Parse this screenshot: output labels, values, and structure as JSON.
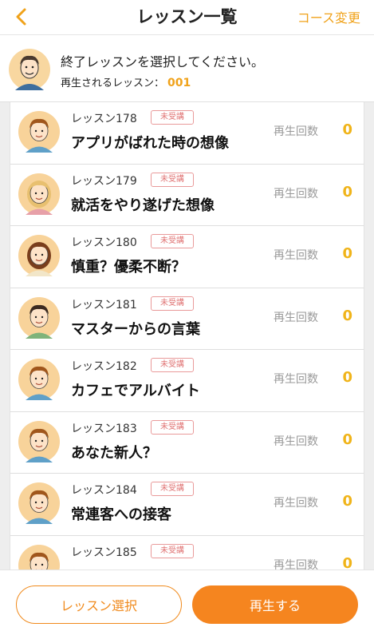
{
  "header": {
    "title": "レッスン一覧",
    "course_change": "コース変更"
  },
  "info": {
    "message": "終了レッスンを選択してください。",
    "current_label": "再生されるレッスン：",
    "current_number": "001"
  },
  "lessons": [
    {
      "label": "レッスン178",
      "badge": "未受講",
      "title": "アプリがばれた時の想像",
      "play_label": "再生回数",
      "play_count": "0"
    },
    {
      "label": "レッスン179",
      "badge": "未受講",
      "title": "就活をやり遂げた想像",
      "play_label": "再生回数",
      "play_count": "0"
    },
    {
      "label": "レッスン180",
      "badge": "未受講",
      "title": "慎重？優柔不断？",
      "play_label": "再生回数",
      "play_count": "0"
    },
    {
      "label": "レッスン181",
      "badge": "未受講",
      "title": "マスターからの言葉",
      "play_label": "再生回数",
      "play_count": "0"
    },
    {
      "label": "レッスン182",
      "badge": "未受講",
      "title": "カフェでアルバイト",
      "play_label": "再生回数",
      "play_count": "0"
    },
    {
      "label": "レッスン183",
      "badge": "未受講",
      "title": "あなた新人？",
      "play_label": "再生回数",
      "play_count": "0"
    },
    {
      "label": "レッスン184",
      "badge": "未受講",
      "title": "常連客への接客",
      "play_label": "再生回数",
      "play_count": "0"
    },
    {
      "label": "レッスン185",
      "badge": "未受講",
      "title": "",
      "play_label": "再生回数",
      "play_count": "0"
    }
  ],
  "footer": {
    "select_label": "レッスン選択",
    "play_label": "再生する"
  },
  "colors": {
    "accent": "#f5851f",
    "count": "#f0b41a",
    "badge": "#e07474"
  }
}
